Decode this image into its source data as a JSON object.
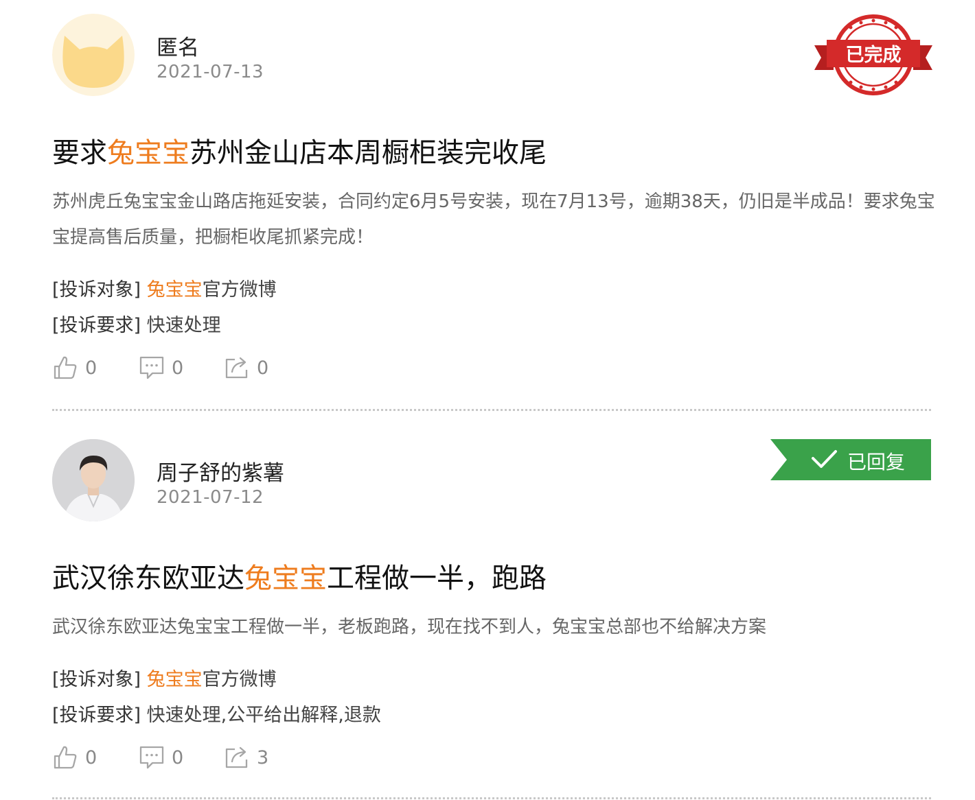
{
  "posts": [
    {
      "user_name": "匿名",
      "date": "2021-07-13",
      "status": "已完成",
      "title_pre": "要求",
      "title_highlight": "兔宝宝",
      "title_post": "苏州金山店本周橱柜装完收尾",
      "body": "苏州虎丘兔宝宝金山路店拖延安装，合同约定6月5号安装，现在7月13号，逾期38天，仍旧是半成品！要求兔宝宝提高售后质量，把橱柜收尾抓紧完成！",
      "target_label": "[投诉对象]",
      "target_highlight": "兔宝宝",
      "target_rest": "官方微博",
      "demand_label": "[投诉要求]",
      "demand_value": "快速处理",
      "likes": "0",
      "comments": "0",
      "shares": "0"
    },
    {
      "user_name": "周子舒的紫薯",
      "date": "2021-07-12",
      "status": "已回复",
      "title_pre": "武汉徐东欧亚达",
      "title_highlight": "兔宝宝",
      "title_post": "工程做一半，跑路",
      "body": "武汉徐东欧亚达兔宝宝工程做一半，老板跑路，现在找不到人，兔宝宝总部也不给解决方案",
      "target_label": "[投诉对象]",
      "target_highlight": "兔宝宝",
      "target_rest": "官方微博",
      "demand_label": "[投诉要求]",
      "demand_value": "快速处理,公平给出解释,退款",
      "likes": "0",
      "comments": "0",
      "shares": "3"
    }
  ],
  "colors": {
    "highlight": "#ee7c1e",
    "stamp_red": "#d42a2a",
    "badge_green": "#3aa24a",
    "divider": "#c8c8c8"
  },
  "icons": [
    "thumbs-up-icon",
    "comment-icon",
    "share-icon",
    "check-icon",
    "cat-avatar",
    "user-photo-avatar"
  ]
}
